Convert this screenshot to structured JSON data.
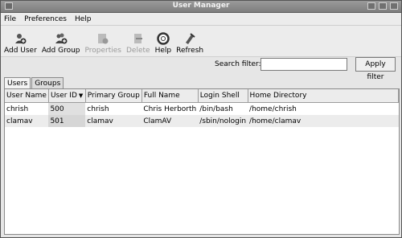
{
  "window": {
    "title": "User Manager"
  },
  "menu": {
    "items": [
      "File",
      "Preferences",
      "Help"
    ]
  },
  "toolbar": {
    "buttons": [
      {
        "label": "Add User",
        "icon": "add-user-icon",
        "enabled": true
      },
      {
        "label": "Add Group",
        "icon": "add-group-icon",
        "enabled": true
      },
      {
        "label": "Properties",
        "icon": "properties-icon",
        "enabled": false
      },
      {
        "label": "Delete",
        "icon": "delete-icon",
        "enabled": false
      },
      {
        "label": "Help",
        "icon": "help-icon",
        "enabled": true
      },
      {
        "label": "Refresh",
        "icon": "refresh-icon",
        "enabled": true
      }
    ]
  },
  "search": {
    "label": "Search filter:",
    "value": "",
    "apply_label": "Apply filter"
  },
  "tabs": [
    {
      "label": "Users",
      "active": true
    },
    {
      "label": "Groups",
      "active": false
    }
  ],
  "table": {
    "columns": [
      "User Name",
      "User ID",
      "Primary Group",
      "Full Name",
      "Login Shell",
      "Home Directory"
    ],
    "sorted_column": "User ID",
    "rows": [
      [
        "chrish",
        "500",
        "chrish",
        "Chris Herborth",
        "/bin/bash",
        "/home/chrish"
      ],
      [
        "clamav",
        "501",
        "clamav",
        "ClamAV",
        "/sbin/nologin",
        "/home/clamav"
      ]
    ]
  }
}
